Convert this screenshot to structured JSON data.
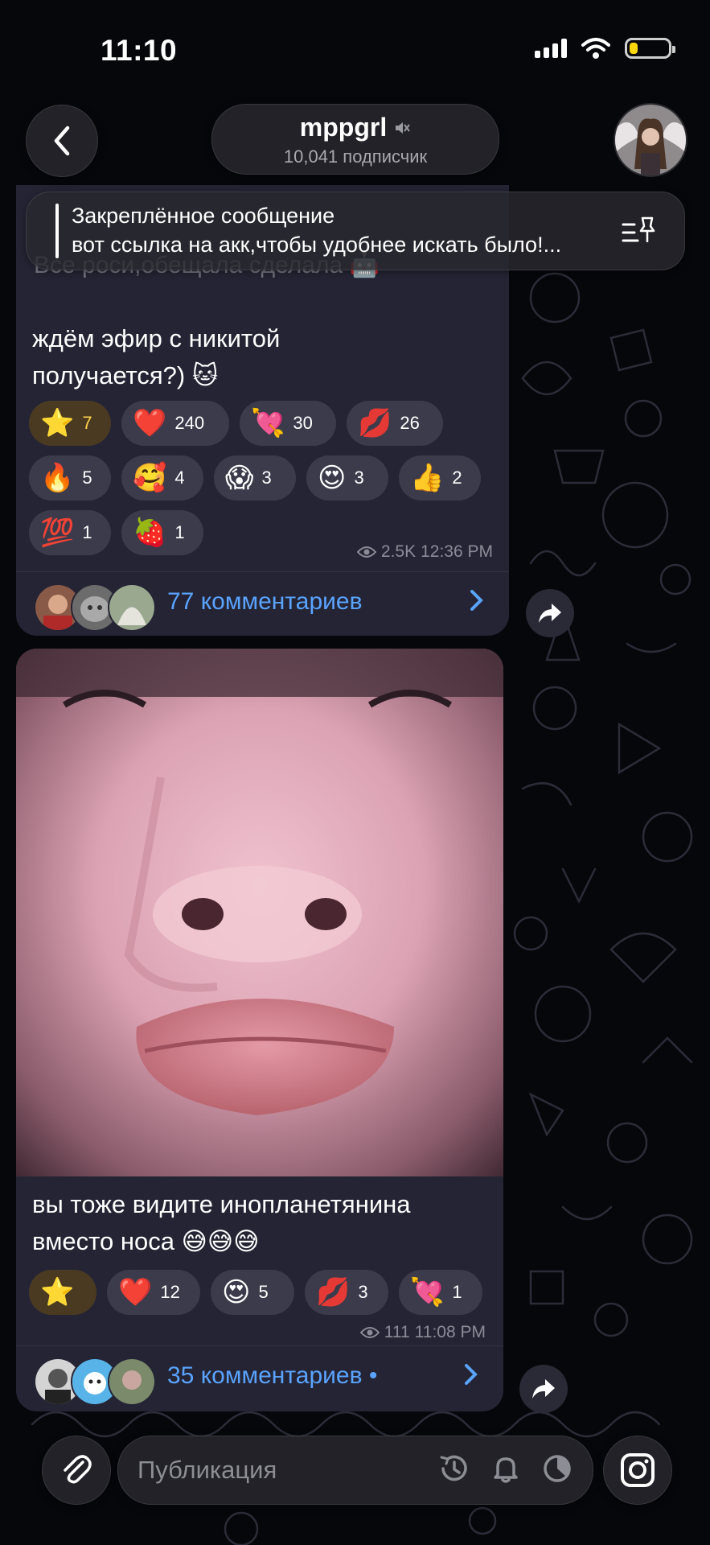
{
  "status_bar": {
    "time": "11:10"
  },
  "header": {
    "channel_name": "mppgrl",
    "subscribers": "10,041 подписчик"
  },
  "pinned": {
    "title": "Закреплённое сообщение",
    "text": "вот ссылка на акк,чтобы удобнее искать было!..."
  },
  "message1": {
    "faded_text": "Все роси,обещала сделала 🤖",
    "text_line1": "ждём эфир с никитой",
    "text_line2": "получается?) 🐱",
    "reactions": [
      {
        "emoji": "⭐",
        "count": "7"
      },
      {
        "emoji": "❤️",
        "count": "240"
      },
      {
        "emoji": "💘",
        "count": "30"
      },
      {
        "emoji": "💋",
        "count": "26"
      },
      {
        "emoji": "🔥",
        "count": "5"
      },
      {
        "emoji": "🥰",
        "count": "4"
      },
      {
        "emoji": "😱",
        "count": "3"
      },
      {
        "emoji": "😍",
        "count": "3"
      },
      {
        "emoji": "👍",
        "count": "2"
      },
      {
        "emoji": "💯",
        "count": "1"
      },
      {
        "emoji": "🍓",
        "count": "1"
      }
    ],
    "views": "2.5K",
    "time": "12:36 PM",
    "comments": "77 комментариев"
  },
  "message2": {
    "text_line1": "вы тоже видите инопланетянина",
    "text_line2": "вместо носа 😅😅😅",
    "reactions": [
      {
        "emoji": "⭐",
        "count": ""
      },
      {
        "emoji": "❤️",
        "count": "12"
      },
      {
        "emoji": "😍",
        "count": "5"
      },
      {
        "emoji": "💋",
        "count": "3"
      },
      {
        "emoji": "💘",
        "count": "1"
      }
    ],
    "views": "111",
    "time": "11:08 PM",
    "comments": "35 комментариев •"
  },
  "composer": {
    "placeholder": "Публикация"
  },
  "colors": {
    "accent": "#5aa3ff",
    "bubble": "#242434",
    "reaction": "#3b3b4b",
    "battery": "#ffd60a"
  },
  "icons": [
    "back-arrow-icon",
    "mute-icon",
    "pin-list-icon",
    "eye-icon",
    "chevron-right-icon",
    "share-icon",
    "paperclip-icon",
    "timer-icon",
    "bell-icon",
    "clock-half-icon",
    "instagram-icon"
  ]
}
